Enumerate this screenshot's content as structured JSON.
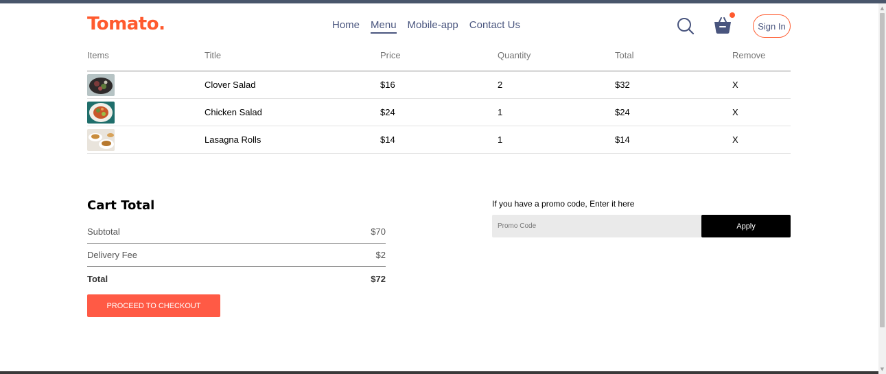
{
  "header": {
    "logo": "Tomato.",
    "nav": [
      "Home",
      "Menu",
      "Mobile-app",
      "Contact Us"
    ],
    "active_nav": "Menu",
    "sign_in": "Sign In",
    "brand_color": "#ff5a2e"
  },
  "cart": {
    "columns": [
      "Items",
      "Title",
      "Price",
      "Quantity",
      "Total",
      "Remove"
    ],
    "rows": [
      {
        "title": "Clover Salad",
        "price": "$16",
        "quantity": "2",
        "total": "$32",
        "remove": "X"
      },
      {
        "title": "Chicken Salad",
        "price": "$24",
        "quantity": "1",
        "total": "$24",
        "remove": "X"
      },
      {
        "title": "Lasagna Rolls",
        "price": "$14",
        "quantity": "1",
        "total": "$14",
        "remove": "X"
      }
    ]
  },
  "cart_total": {
    "title": "Cart Total",
    "subtotal_label": "Subtotal",
    "subtotal_value": "$70",
    "delivery_label": "Delivery Fee",
    "delivery_value": "$2",
    "total_label": "Total",
    "total_value": "$72",
    "checkout": "PROCEED TO CHECKOUT"
  },
  "promo": {
    "label": "If you have a promo code, Enter it here",
    "placeholder": "Promo Code",
    "apply": "Apply"
  }
}
